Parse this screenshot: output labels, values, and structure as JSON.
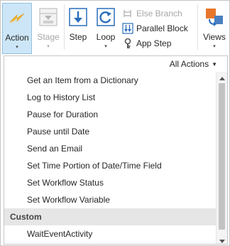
{
  "ribbon": {
    "action": {
      "label": "Action",
      "caret": "▾",
      "icon": "lightning-icon"
    },
    "stage": {
      "label": "Stage",
      "caret": "▾",
      "icon": "stage-icon"
    },
    "step": {
      "label": "Step",
      "icon": "step-arrow-icon"
    },
    "loop": {
      "label": "Loop",
      "caret": "▾",
      "icon": "loop-icon"
    },
    "else_branch": {
      "label": "Else Branch",
      "icon": "else-branch-icon"
    },
    "parallel_block": {
      "label": "Parallel Block",
      "icon": "parallel-block-icon"
    },
    "app_step": {
      "label": "App Step",
      "icon": "app-step-icon"
    },
    "views": {
      "label": "Views",
      "caret": "▾",
      "icon": "views-icon"
    }
  },
  "panel": {
    "filter_label": "All Actions",
    "filter_caret": "▼",
    "items": [
      "Get an Item from a Dictionary",
      "Log to History List",
      "Pause for Duration",
      "Pause until Date",
      "Send an Email",
      "Set Time Portion of Date/Time Field",
      "Set Workflow Status",
      "Set Workflow Variable"
    ],
    "category": "Custom",
    "custom_items": [
      "WaitEventActivity"
    ]
  },
  "colors": {
    "active_bg": "#cde6f7",
    "accent_blue": "#2a6ebb",
    "lightning": "#f5b52e",
    "views_orange": "#e8762c"
  }
}
